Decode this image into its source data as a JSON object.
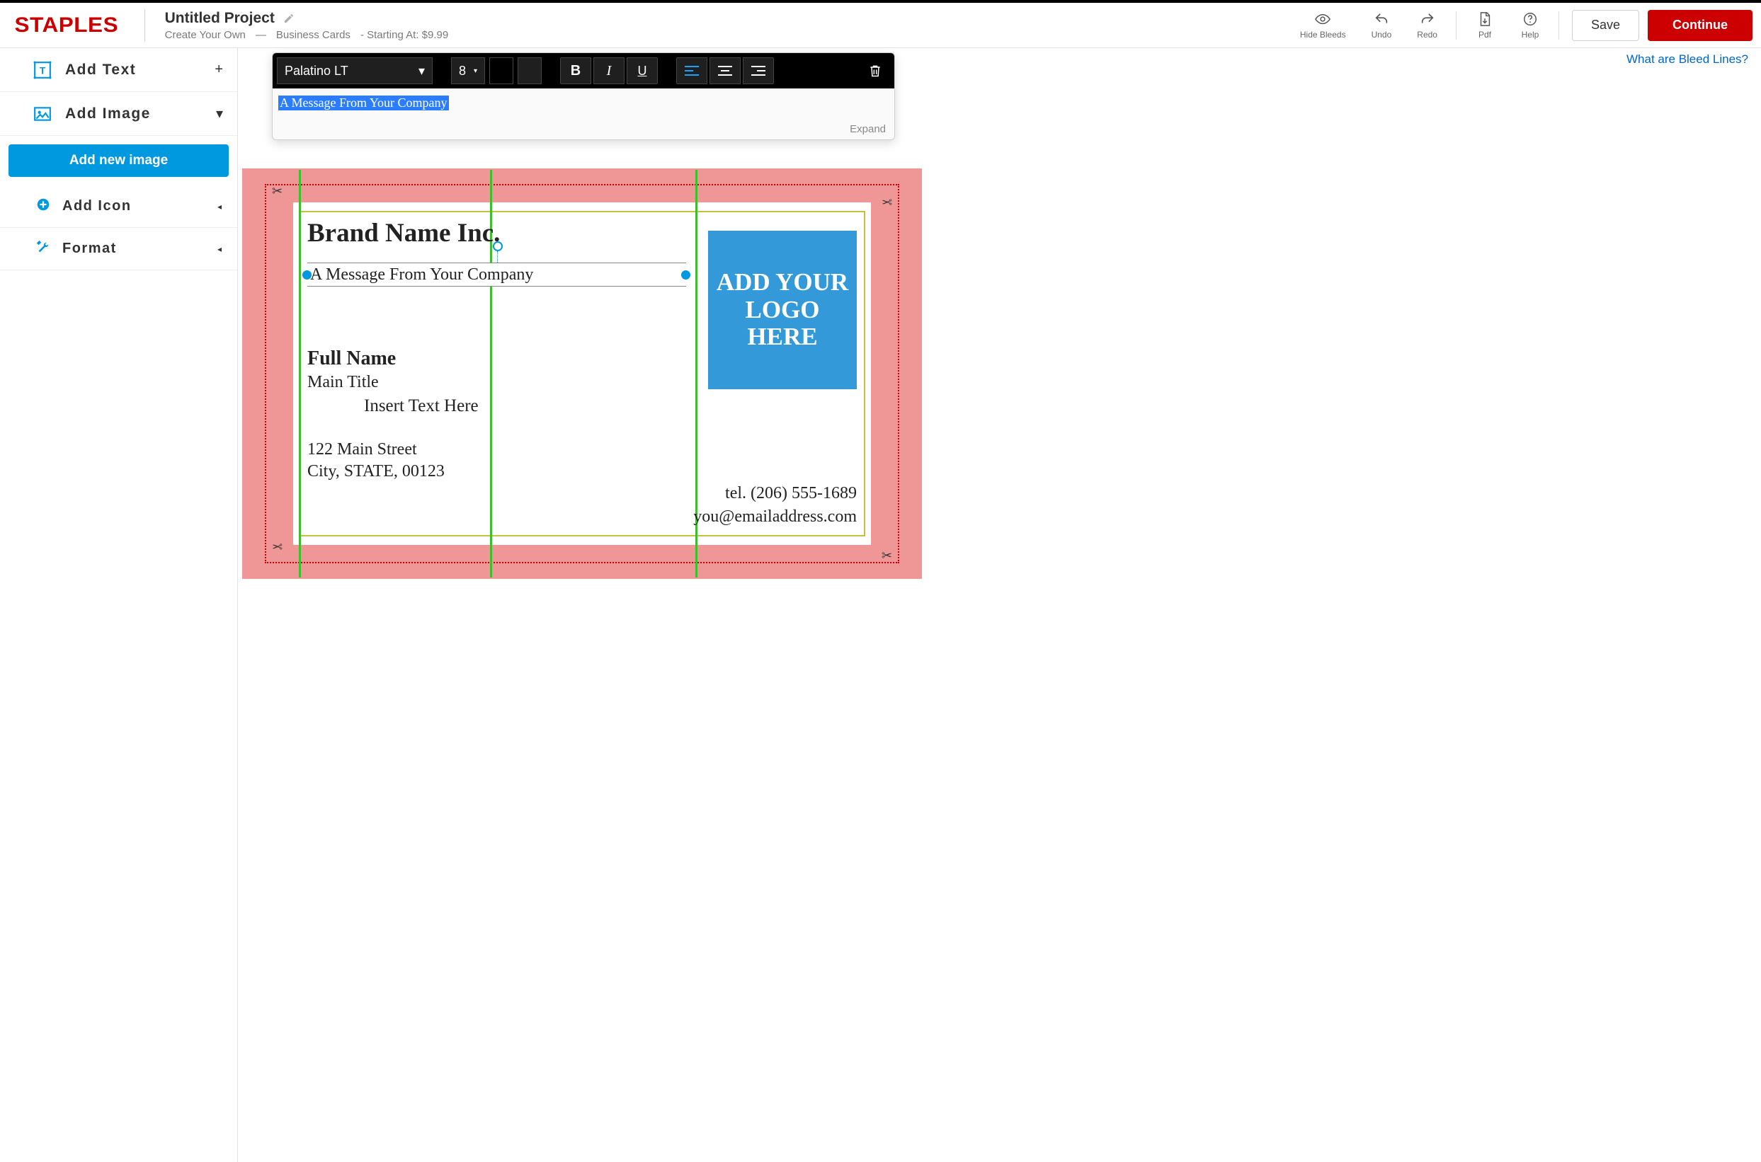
{
  "header": {
    "logo_text": "STAPLES",
    "project_title": "Untitled Project",
    "breadcrumb": {
      "a": "Create Your Own",
      "b": "Business Cards",
      "c": "- Starting At: $9.99"
    },
    "actions": {
      "hide_bleeds": "Hide Bleeds",
      "undo": "Undo",
      "redo": "Redo",
      "pdf": "Pdf",
      "help": "Help"
    },
    "save_label": "Save",
    "continue_label": "Continue"
  },
  "sidebar": {
    "add_text": "Add  Text",
    "add_image": "Add  Image",
    "add_new_image": "Add new image",
    "add_icon": "Add  Icon",
    "format": "Format"
  },
  "canvas": {
    "bleed_link": "What are Bleed Lines?",
    "editor": {
      "font": "Palatino LT",
      "size": "8",
      "selected_text": "A Message From Your Company",
      "expand": "Expand"
    },
    "card": {
      "brand": "Brand Name Inc.",
      "message": "A Message From Your Company",
      "full_name": "Full Name",
      "main_title": "Main Title",
      "insert_text": "Insert Text Here",
      "addr1": "122 Main Street",
      "addr2": "City, STATE, 00123",
      "tel": "tel. (206) 555-1689",
      "email": "you@emailaddress.com",
      "logo_placeholder": "ADD YOUR LOGO HERE"
    }
  }
}
